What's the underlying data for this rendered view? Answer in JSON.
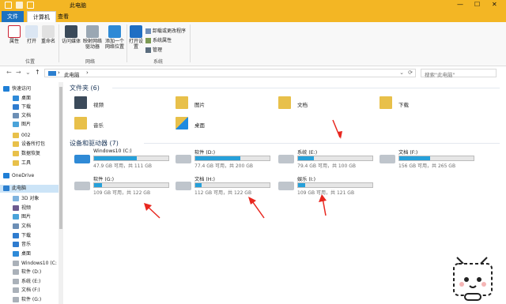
{
  "window": {
    "title": "此电脑",
    "minimize": "—",
    "maximize": "☐",
    "close": "✕"
  },
  "tabs": {
    "file": "文件",
    "computer": "计算机",
    "view": "查看"
  },
  "ribbon": {
    "location": {
      "properties": "属性",
      "open": "打开",
      "rename": "重命名",
      "group": "位置"
    },
    "network": {
      "access_media": "访问媒体",
      "map_drive": "映射网络驱动器",
      "add_location": "添加一个网络位置",
      "group": "网络"
    },
    "system": {
      "open_settings": "打开设置",
      "uninstall": "卸载或更改程序",
      "sys_props": "系统属性",
      "manage": "管理",
      "group": "系统"
    }
  },
  "address": {
    "back": "←",
    "forward": "→",
    "down": "⌄",
    "up": "↑",
    "path": "此电脑",
    "chevron": "›",
    "refresh": "⟳",
    "search_placeholder": "搜索\"此电脑\""
  },
  "sidebar": {
    "items": [
      "快速访问",
      "桌面",
      "下载",
      "文档",
      "图片",
      "002",
      "设备所打包",
      "数据恢复",
      "工具",
      "OneDrive",
      "此电脑",
      "3D 对象",
      "视频",
      "图片",
      "文档",
      "下载",
      "音乐",
      "桌面",
      "Windows10 (C:",
      "软件 (D:)",
      "系统 (E:)",
      "文档 (F:)",
      "软件 (G:)"
    ]
  },
  "folders": {
    "header": "文件夹 (6)",
    "items": [
      "视频",
      "图片",
      "文档",
      "下载",
      "音乐",
      "桌面"
    ]
  },
  "drives": {
    "header": "设备和驱动器 (7)",
    "items": [
      {
        "name": "Windows10 (C:)",
        "status": "47.9 GB 可用，共 111 GB",
        "used": 0.57
      },
      {
        "name": "软件 (D:)",
        "status": "77.4 GB 可用，共 200 GB",
        "used": 0.61
      },
      {
        "name": "系统 (E:)",
        "status": "79.4 GB 可用，共 100 GB",
        "used": 0.21
      },
      {
        "name": "文档 (F:)",
        "status": "156 GB 可用，共 265 GB",
        "used": 0.41
      },
      {
        "name": "软件 (G:)",
        "status": "109 GB 可用，共 122 GB",
        "used": 0.11
      },
      {
        "name": "文档 (H:)",
        "status": "112 GB 可用，共 122 GB",
        "used": 0.08
      },
      {
        "name": "娱乐 (I:)",
        "status": "109 GB 可用，共 121 GB",
        "used": 0.1
      }
    ]
  },
  "colors": {
    "accent": "#f3b624",
    "bar": "#26a0da",
    "arrow": "#e8271f"
  }
}
